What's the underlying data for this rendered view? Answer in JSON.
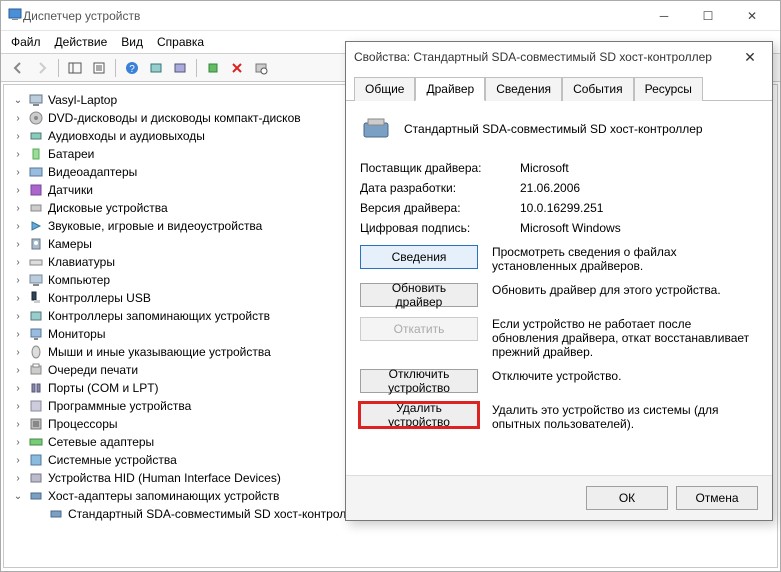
{
  "window": {
    "title": "Диспетчер устройств"
  },
  "menu": {
    "file": "Файл",
    "action": "Действие",
    "view": "Вид",
    "help": "Справка"
  },
  "tree": {
    "root": "Vasyl-Laptop",
    "nodes": [
      "DVD-дисководы и дисководы компакт-дисков",
      "Аудиовходы и аудиовыходы",
      "Батареи",
      "Видеоадаптеры",
      "Датчики",
      "Дисковые устройства",
      "Звуковые, игровые и видеоустройства",
      "Камеры",
      "Клавиатуры",
      "Компьютер",
      "Контроллеры USB",
      "Контроллеры запоминающих устройств",
      "Мониторы",
      "Мыши и иные указывающие устройства",
      "Очереди печати",
      "Порты (COM и LPT)",
      "Программные устройства",
      "Процессоры",
      "Сетевые адаптеры",
      "Системные устройства",
      "Устройства HID (Human Interface Devices)",
      "Хост-адаптеры запоминающих устройств"
    ],
    "subitem": "Стандартный SDA-совместимый SD хост-контроллер"
  },
  "dialog": {
    "title": "Свойства: Стандартный SDA-совместимый SD хост-контроллер",
    "tabs": {
      "general": "Общие",
      "driver": "Драйвер",
      "details": "Сведения",
      "events": "События",
      "resources": "Ресурсы"
    },
    "device_name": "Стандартный SDA-совместимый SD хост-контроллер",
    "rows": {
      "provider_label": "Поставщик драйвера:",
      "provider_value": "Microsoft",
      "date_label": "Дата разработки:",
      "date_value": "21.06.2006",
      "version_label": "Версия драйвера:",
      "version_value": "10.0.16299.251",
      "sig_label": "Цифровая подпись:",
      "sig_value": "Microsoft Windows"
    },
    "buttons": {
      "details": "Сведения",
      "details_desc": "Просмотреть сведения о файлах установленных драйверов.",
      "update": "Обновить драйвер",
      "update_desc": "Обновить драйвер для этого устройства.",
      "rollback": "Откатить",
      "rollback_desc": "Если устройство не работает после обновления драйвера, откат восстанавливает прежний драйвер.",
      "disable": "Отключить устройство",
      "disable_desc": "Отключите устройство.",
      "uninstall": "Удалить устройство",
      "uninstall_desc": "Удалить это устройство из системы (для опытных пользователей)."
    },
    "footer": {
      "ok": "ОК",
      "cancel": "Отмена"
    }
  }
}
